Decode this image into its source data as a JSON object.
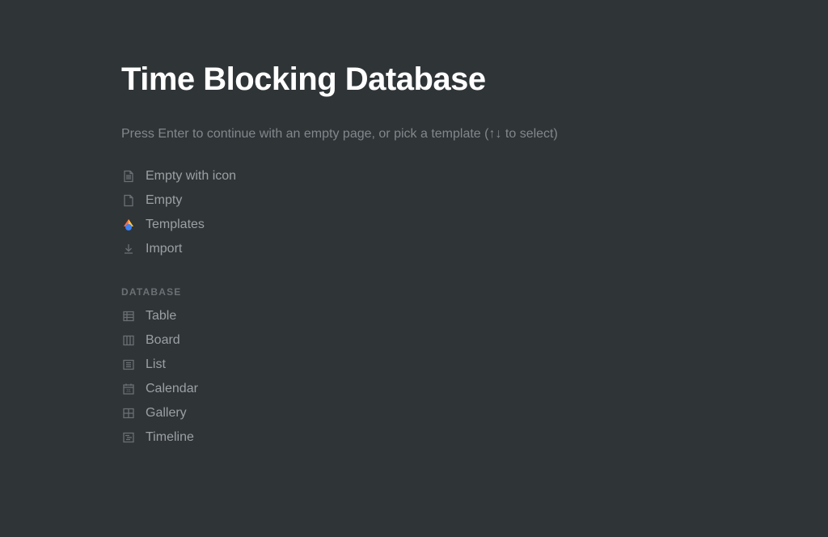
{
  "page": {
    "title": "Time Blocking Database",
    "hint": "Press Enter to continue with an empty page, or pick a template (↑↓ to select)"
  },
  "primary_options": [
    {
      "label": "Empty with icon",
      "icon": "page-with-lines-icon"
    },
    {
      "label": "Empty",
      "icon": "page-icon"
    },
    {
      "label": "Templates",
      "icon": "templates-icon"
    },
    {
      "label": "Import",
      "icon": "download-icon"
    }
  ],
  "database_section": {
    "header": "DATABASE",
    "options": [
      {
        "label": "Table",
        "icon": "table-icon"
      },
      {
        "label": "Board",
        "icon": "board-icon"
      },
      {
        "label": "List",
        "icon": "list-icon"
      },
      {
        "label": "Calendar",
        "icon": "calendar-icon"
      },
      {
        "label": "Gallery",
        "icon": "gallery-icon"
      },
      {
        "label": "Timeline",
        "icon": "timeline-icon"
      }
    ]
  }
}
